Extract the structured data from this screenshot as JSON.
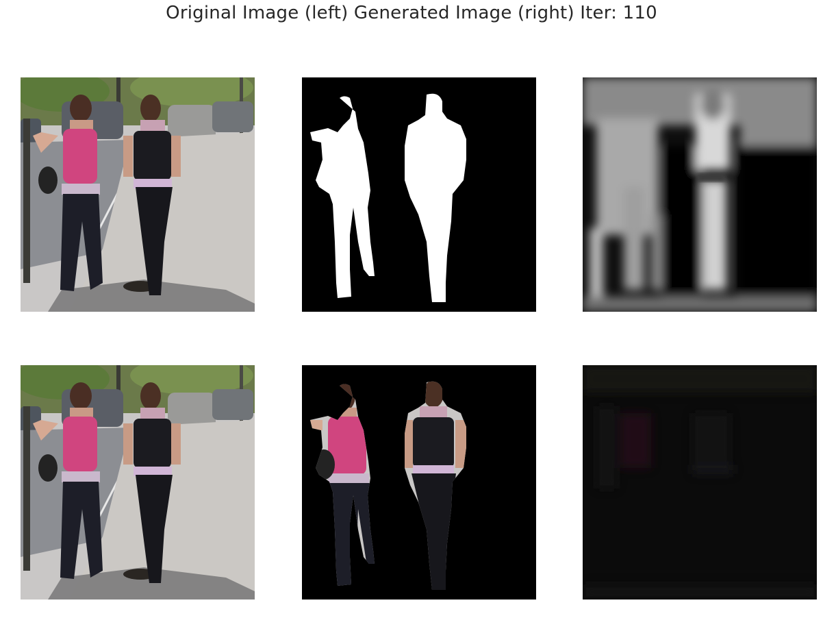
{
  "figure": {
    "title": "Original Image (left) Generated Image (right) Iter: 110"
  },
  "panels": [
    {
      "id": "r1c1",
      "content": "photo"
    },
    {
      "id": "r1c2",
      "content": "mask"
    },
    {
      "id": "r1c3",
      "content": "predicted-mask"
    },
    {
      "id": "r2c1",
      "content": "photo"
    },
    {
      "id": "r2c2",
      "content": "masked-photo"
    },
    {
      "id": "r2c3",
      "content": "generated-residual"
    }
  ],
  "colors": {
    "background": "#ffffff",
    "title_text": "#262626",
    "mask_foreground": "#ffffff",
    "mask_background": "#000000",
    "pink_top": "#d0457f",
    "black_top": "#1b1b20"
  }
}
